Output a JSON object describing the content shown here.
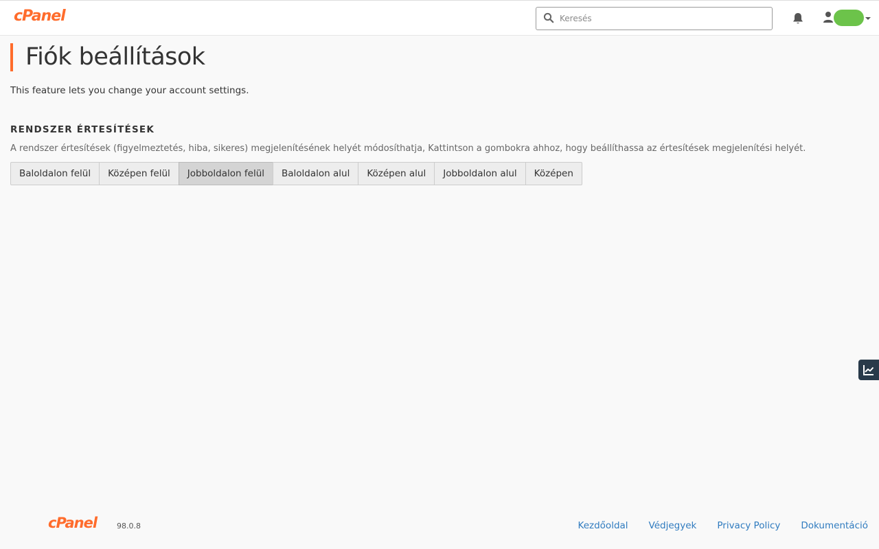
{
  "header": {
    "logo": "cPanel",
    "search": {
      "placeholder": "Keresés",
      "value": ""
    },
    "notifications_icon": "bell-icon",
    "user_icon": "user-icon"
  },
  "page": {
    "title": "Fiók beállítások",
    "description": "This feature lets you change your account settings."
  },
  "notifications_section": {
    "heading": "RENDSZER ÉRTESÍTÉSEK",
    "description": "A rendszer értesítések (figyelmeztetés, hiba, sikeres) megjelenítésének helyét módosíthatja, Kattintson a gombokra ahhoz, hogy beállíthassa az értesítések megjelenítési helyét.",
    "positions": [
      {
        "label": "Baloldalon felül",
        "selected": false
      },
      {
        "label": "Középen felül",
        "selected": false
      },
      {
        "label": "Jobboldalon felül",
        "selected": true
      },
      {
        "label": "Baloldalon alul",
        "selected": false
      },
      {
        "label": "Középen alul",
        "selected": false
      },
      {
        "label": "Jobboldalon alul",
        "selected": false
      },
      {
        "label": "Középen",
        "selected": false
      }
    ]
  },
  "side_tab": {
    "icon": "chart-line-icon"
  },
  "footer": {
    "logo": "cPanel",
    "version": "98.0.8",
    "links": [
      "Kezdőoldal",
      "Védjegyek",
      "Privacy Policy",
      "Dokumentáció"
    ]
  },
  "colors": {
    "brand_orange": "#ff6c2c",
    "link_blue": "#2f7bbf",
    "side_tab_bg": "#293a4a",
    "active_button_bg": "#d4d4d4"
  }
}
